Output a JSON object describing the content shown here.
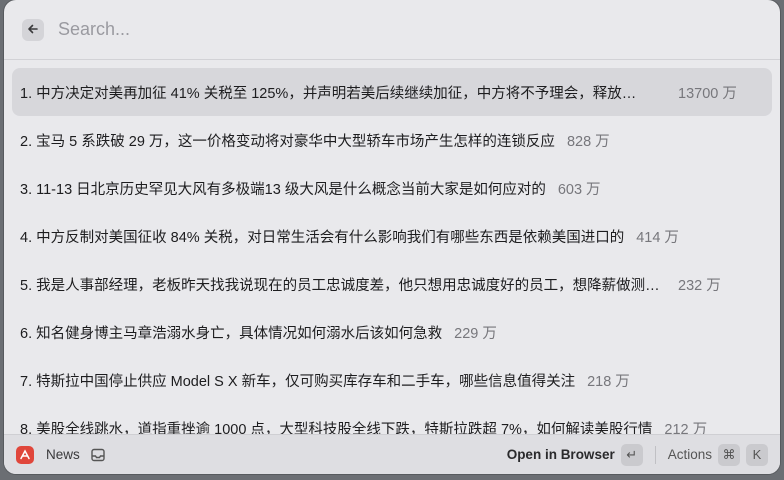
{
  "search": {
    "placeholder": "Search..."
  },
  "results": [
    {
      "title": "1. 中方决定对美再加征 41% 关税至 125%，并声明若美后续继续加征，中方将不予理会，释放…",
      "count": "13700 万",
      "selected": true
    },
    {
      "title": "2. 宝马 5 系跌破 29 万，这一价格变动将对豪华中大型轿车市场产生怎样的连锁反应",
      "count": "828 万"
    },
    {
      "title": "3. 11-13 日北京历史罕见大风有多极端13 级大风是什么概念当前大家是如何应对的",
      "count": "603 万"
    },
    {
      "title": "4. 中方反制对美国征收 84% 关税，对日常生活会有什么影响我们有哪些东西是依赖美国进口的",
      "count": "414 万"
    },
    {
      "title": "5. 我是人事部经理，老板昨天找我说现在的员工忠诚度差，他只想用忠诚度好的员工，想降薪做测…",
      "count": "232 万"
    },
    {
      "title": "6. 知名健身博主马章浩溺水身亡，具体情况如何溺水后该如何急救",
      "count": "229 万"
    },
    {
      "title": "7. 特斯拉中国停止供应 Model S  X 新车，仅可购买库存车和二手车，哪些信息值得关注",
      "count": "218 万"
    },
    {
      "title": "8. 美股全线跳水，道指重挫逾 1000 点，大型科技股全线下跌，特斯拉跌超 7%，如何解读美股行情",
      "count": "212 万"
    }
  ],
  "footer": {
    "app_name": "News",
    "primary_action": "Open in Browser",
    "primary_key": "↵",
    "actions_label": "Actions",
    "actions_keys": [
      "⌘",
      "K"
    ]
  },
  "colors": {
    "app_icon": "#e0463b",
    "selected_row": "#d7d7db"
  },
  "icons": {
    "back": "arrow-left-icon",
    "app": "news-app-icon",
    "mini": "inbox-icon",
    "enter": "return-key-icon"
  }
}
